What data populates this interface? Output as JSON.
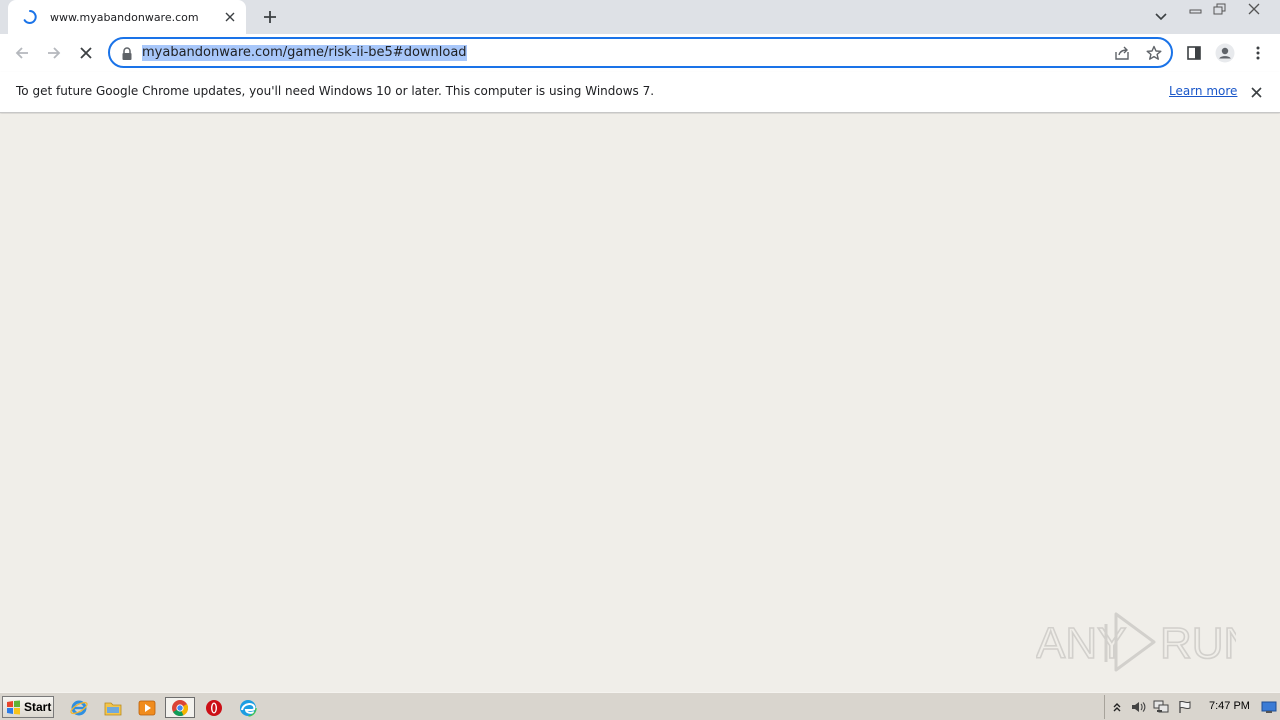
{
  "browser": {
    "tab": {
      "title": "www.myabandonware.com",
      "loading": true
    },
    "omnibox": {
      "url": "myabandonware.com/game/risk-ii-be5#download",
      "secure": true
    }
  },
  "infobar": {
    "message": "To get future Google Chrome updates, you'll need Windows 10 or later. This computer is using Windows 7.",
    "link": "Learn more"
  },
  "watermark": {
    "text_left": "ANY",
    "text_right": "RUN"
  },
  "taskbar": {
    "start_label": "Start",
    "apps": [
      "internet-explorer-icon",
      "file-explorer-icon",
      "media-player-icon",
      "chrome-icon",
      "opera-icon",
      "edge-icon"
    ],
    "clock": "7:47 PM"
  },
  "colors": {
    "accent": "#1a73e8",
    "url_selection": "#a8c7fa",
    "link": "#1a57c9",
    "page_background": "#f0eee9",
    "tabstrip": "#dee1e6"
  }
}
